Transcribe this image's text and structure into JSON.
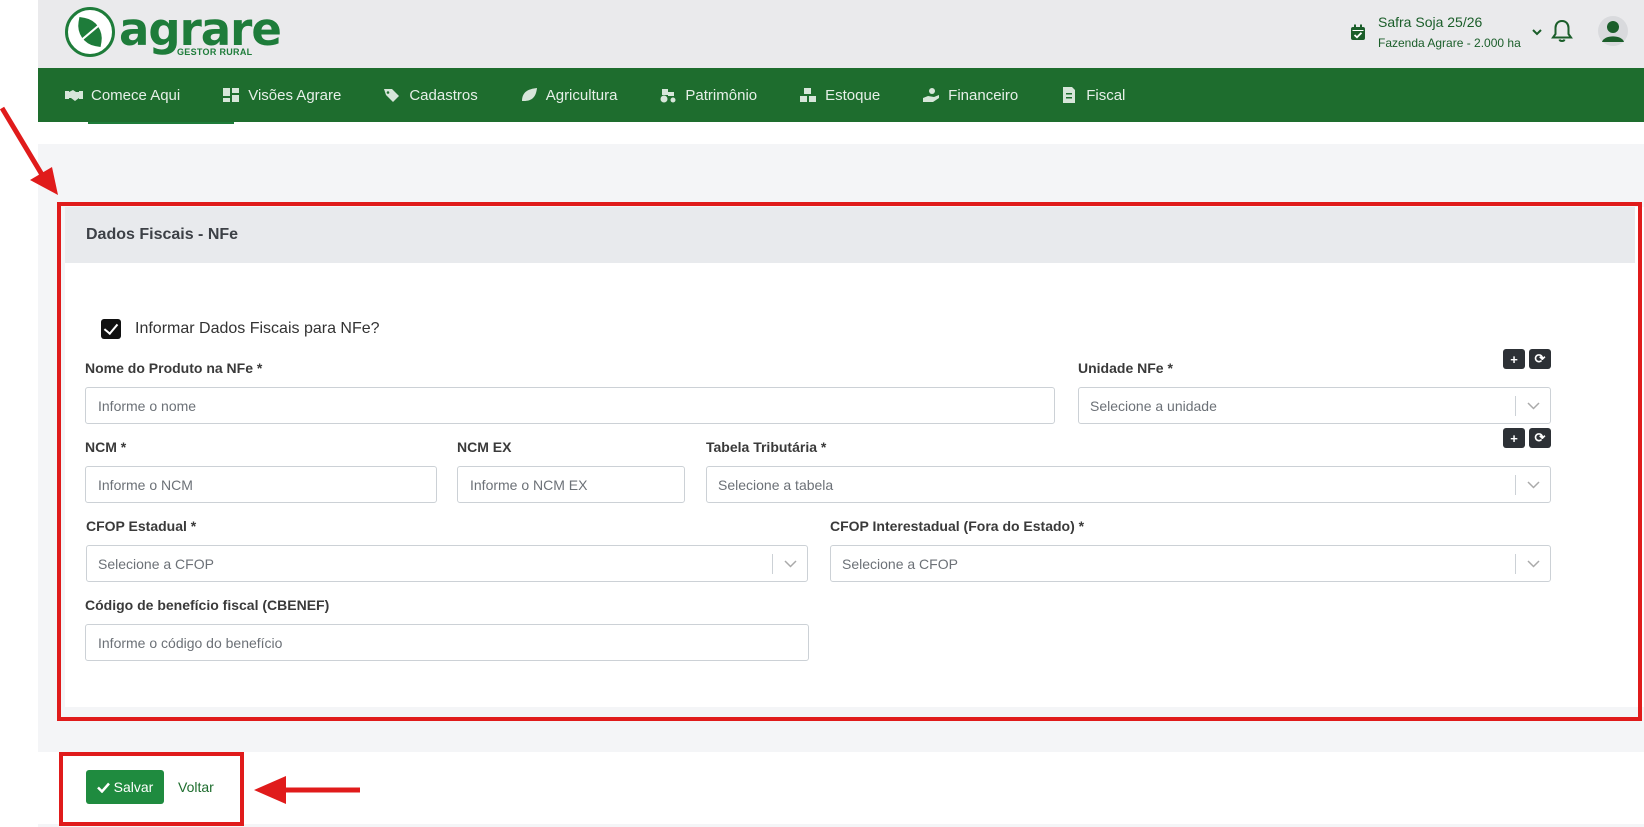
{
  "header": {
    "logo_word": "agrare",
    "logo_sub": "GESTOR RURAL",
    "season_title": "Safra Soja 25/26",
    "season_sub": "Fazenda Agrare - 2.000 ha",
    "colors": {
      "brand_green": "#1e6d2e",
      "accent_green": "#1f8b3f",
      "annotation_red": "#e01b1b"
    }
  },
  "nav": {
    "items": [
      {
        "label": "Comece Aqui",
        "icon": "handshake-icon"
      },
      {
        "label": "Visões Agrare",
        "icon": "dashboard-icon"
      },
      {
        "label": "Cadastros",
        "icon": "tag-icon"
      },
      {
        "label": "Agricultura",
        "icon": "leaf-icon"
      },
      {
        "label": "Patrimônio",
        "icon": "tractor-icon"
      },
      {
        "label": "Estoque",
        "icon": "boxes-icon"
      },
      {
        "label": "Financeiro",
        "icon": "hand-coin-icon"
      },
      {
        "label": "Fiscal",
        "icon": "receipt-icon"
      }
    ]
  },
  "fiscal": {
    "title": "Dados Fiscais - NFe",
    "checkbox_label": "Informar Dados Fiscais para NFe?",
    "checkbox_checked": true,
    "product_name": {
      "label": "Nome do Produto na NFe *",
      "placeholder": "Informe o nome"
    },
    "unit": {
      "label": "Unidade NFe *",
      "placeholder": "Selecione a unidade"
    },
    "ncm": {
      "label": "NCM *",
      "placeholder": "Informe o NCM"
    },
    "ncm_ex": {
      "label": "NCM EX",
      "placeholder": "Informe o NCM EX"
    },
    "tax_table": {
      "label": "Tabela Tributária *",
      "placeholder": "Selecione a tabela"
    },
    "cfop_state": {
      "label": "CFOP Estadual *",
      "placeholder": "Selecione a CFOP"
    },
    "cfop_interstate": {
      "label": "CFOP Interestadual (Fora do Estado) *",
      "placeholder": "Selecione a CFOP"
    },
    "cbenef": {
      "label": "Código de benefício fiscal (CBENEF)",
      "placeholder": "Informe o código do benefício"
    },
    "add_symbol": "+",
    "refresh_symbol": "⟳"
  },
  "actions": {
    "save_label": "Salvar",
    "back_label": "Voltar"
  }
}
